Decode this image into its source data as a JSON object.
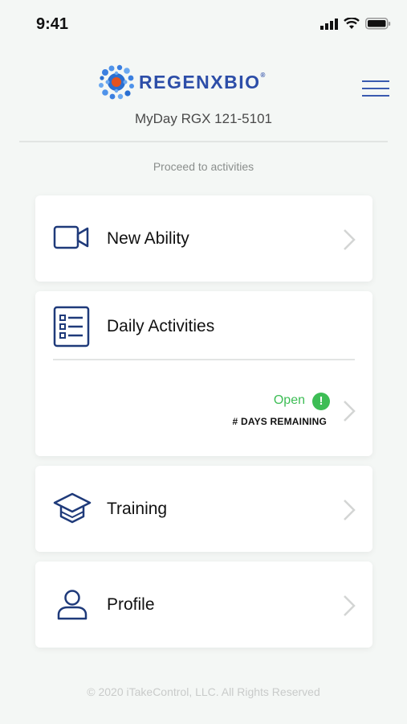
{
  "status_bar": {
    "time": "9:41"
  },
  "header": {
    "logo_text": "REGENXBIO",
    "logo_mark": "®",
    "subtitle": "MyDay RGX 121-5101"
  },
  "prompt": "Proceed to activities",
  "cards": [
    {
      "label": "New Ability",
      "icon": "video-camera-icon"
    },
    {
      "label": "Daily Activities",
      "icon": "checklist-icon",
      "status": "Open",
      "status_badge": "!",
      "remaining": "# DAYS REMAINING"
    },
    {
      "label": "Training",
      "icon": "graduation-cap-icon"
    },
    {
      "label": "Profile",
      "icon": "user-icon"
    }
  ],
  "footer": "© 2020 iTakeControl, LLC.  All Rights Reserved",
  "colors": {
    "accent": "#1f3a7a",
    "brand": "#2d4ea8",
    "status_open": "#3dbd55"
  }
}
